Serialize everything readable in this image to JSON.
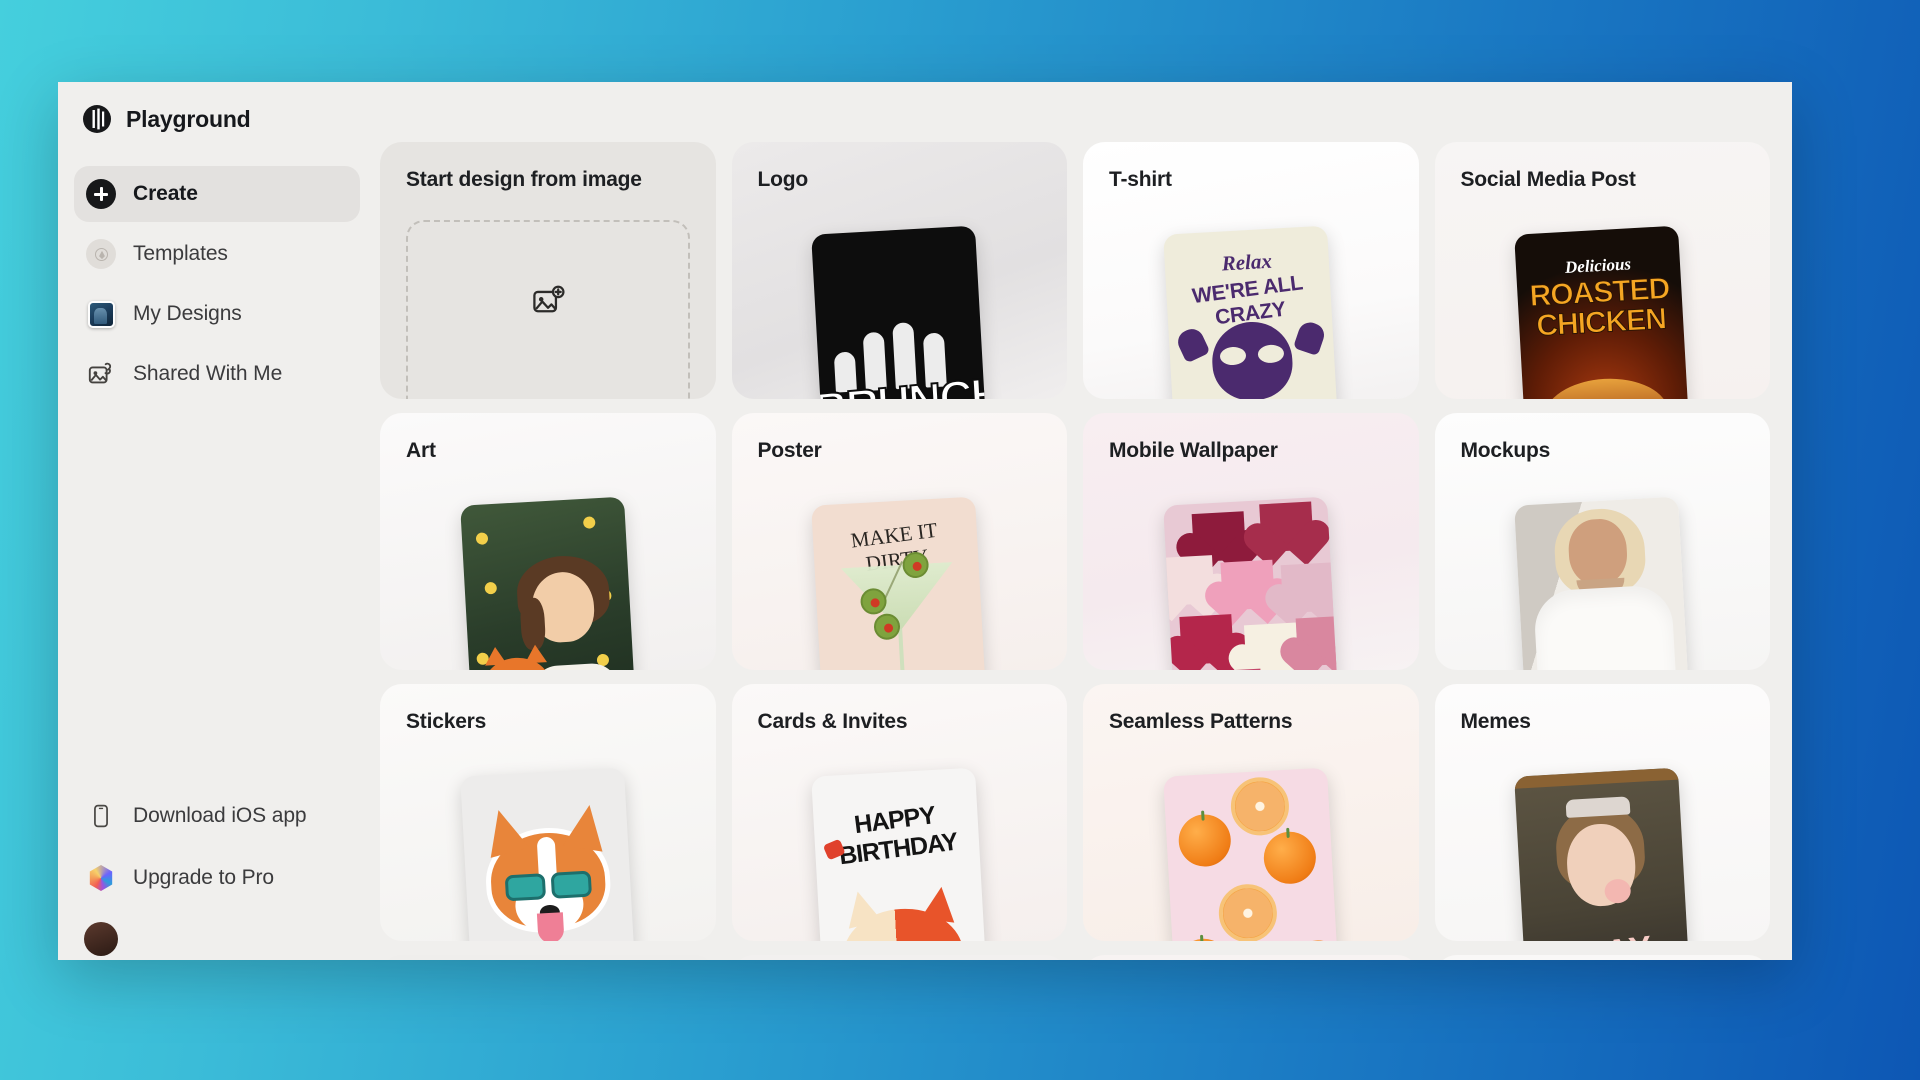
{
  "app": {
    "brand": "Playground",
    "logo_icon": "playground-logo-icon"
  },
  "sidebar": {
    "items": [
      {
        "label": "Create",
        "icon": "plus-circle-icon",
        "active": true
      },
      {
        "label": "Templates",
        "icon": "compass-icon",
        "active": false
      },
      {
        "label": "My Designs",
        "icon": "image-thumb-icon",
        "active": false
      },
      {
        "label": "Shared With Me",
        "icon": "image-link-icon",
        "active": false
      }
    ],
    "bottom_items": [
      {
        "label": "Download iOS app",
        "icon": "mobile-phone-icon"
      },
      {
        "label": "Upgrade to Pro",
        "icon": "pro-hexagon-icon"
      }
    ]
  },
  "main": {
    "upload_card": {
      "title": "Start design from image",
      "icon": "image-plus-icon"
    },
    "cards": [
      {
        "title": "Logo",
        "art": "BRUNCH logo, black card with illustrated hand"
      },
      {
        "title": "T-shirt",
        "art": "Relax WE'RE ALL CRAZY raccoon tee"
      },
      {
        "title": "Social Media Post",
        "art": "Delicious ROASTED CHICKEN food post"
      },
      {
        "title": "Art",
        "art": "Girl hugging a fox in a flower field"
      },
      {
        "title": "Poster",
        "art": "MAKE IT DIRTY martini with olives"
      },
      {
        "title": "Mobile Wallpaper",
        "art": "Plush pink and crimson hearts"
      },
      {
        "title": "Mockups",
        "art": "Model wearing a blank white sweatshirt"
      },
      {
        "title": "Stickers",
        "art": "Corgi wearing teal sunglasses sticker"
      },
      {
        "title": "Cards & Invites",
        "art": "HAPPY BIRTHDAY card with a cat"
      },
      {
        "title": "Seamless Patterns",
        "art": "Oranges and orange slices on pink"
      },
      {
        "title": "Memes",
        "art": "Classical portrait blowing bubble gum, SLAY"
      }
    ],
    "artwork_text": {
      "logo_word": "BRUNCH",
      "tshirt_script": "Relax",
      "tshirt_headline": "WE'RE ALL CRAZY",
      "social_script": "Delicious",
      "social_line1": "ROASTED",
      "social_line2": "CHICKEN",
      "poster_headline": "MAKE IT DIRTY",
      "card_headline": "HAPPY BIRTHDAY",
      "meme_word": "SLAY"
    }
  },
  "theme": {
    "background_gradient_from": "#45cfdd",
    "background_gradient_to": "#0d57b4",
    "panel_bg": "#f0efed",
    "active_nav_bg": "#e3e1df",
    "text_primary": "#16181c",
    "text_secondary": "#3b3b3d"
  }
}
